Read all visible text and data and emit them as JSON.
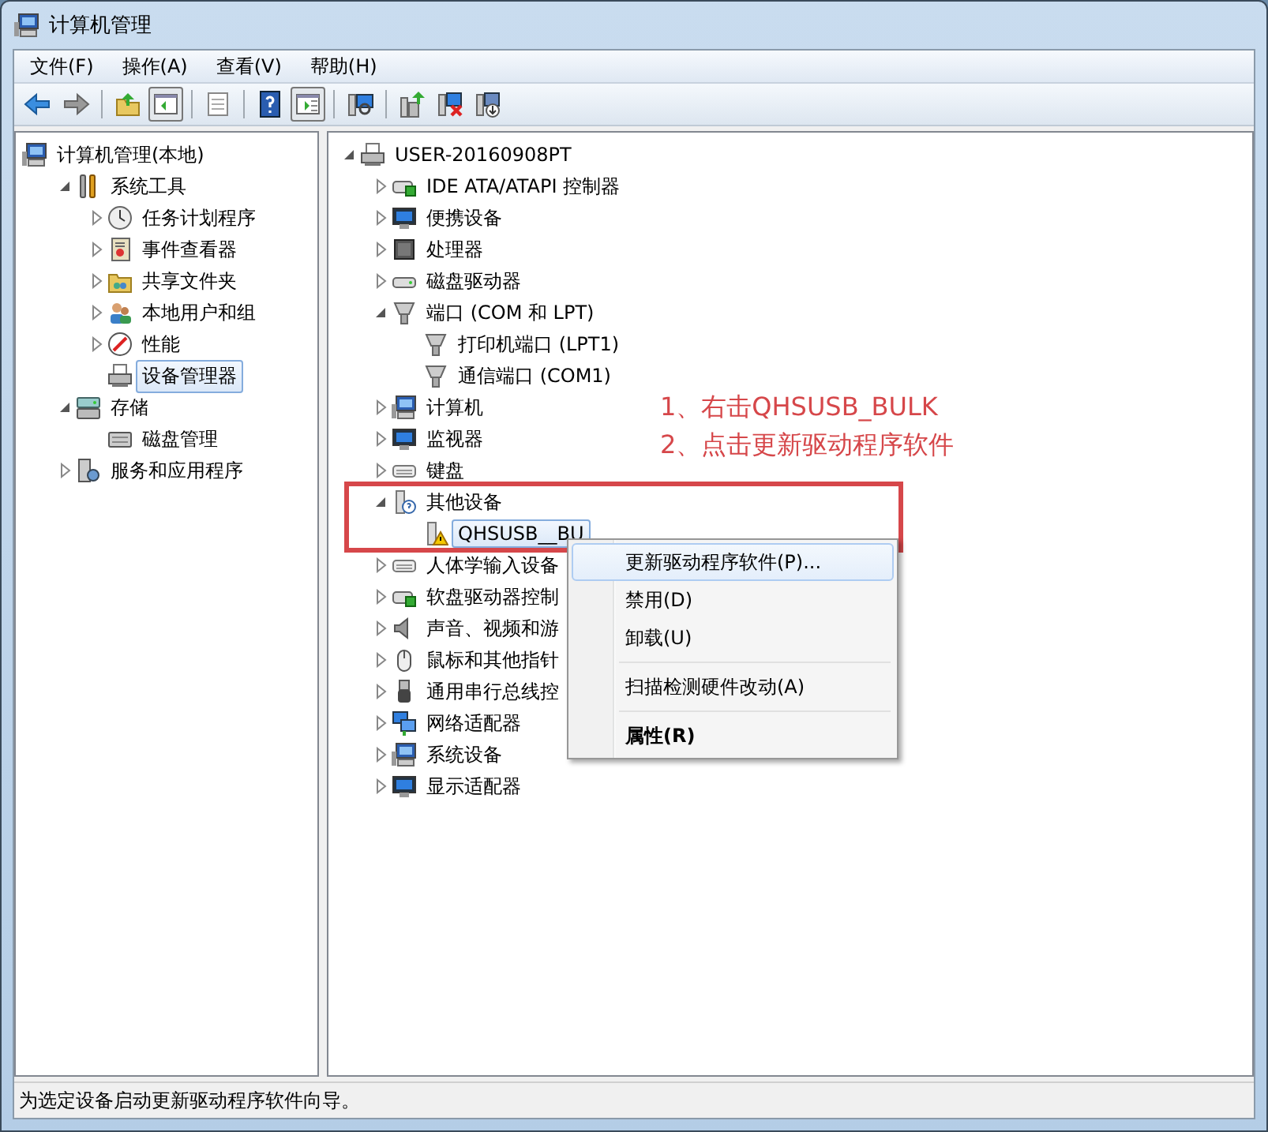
{
  "window": {
    "title": "计算机管理"
  },
  "menu": [
    {
      "label": "文件(F)"
    },
    {
      "label": "操作(A)"
    },
    {
      "label": "查看(V)"
    },
    {
      "label": "帮助(H)"
    }
  ],
  "toolbar": [
    {
      "kind": "back",
      "pressed": false
    },
    {
      "kind": "forward",
      "pressed": false
    },
    {
      "kind": "separator"
    },
    {
      "kind": "up",
      "pressed": false
    },
    {
      "kind": "tree",
      "pressed": true
    },
    {
      "kind": "separator"
    },
    {
      "kind": "page",
      "pressed": false
    },
    {
      "kind": "separator"
    },
    {
      "kind": "help",
      "pressed": false
    },
    {
      "kind": "pane",
      "pressed": true
    },
    {
      "kind": "separator"
    },
    {
      "kind": "scan",
      "pressed": false
    },
    {
      "kind": "separator"
    },
    {
      "kind": "update",
      "pressed": false
    },
    {
      "kind": "remove",
      "pressed": false
    },
    {
      "kind": "install",
      "pressed": false
    }
  ],
  "console_tree": [
    {
      "label": "计算机管理(本地)",
      "selected": false,
      "children": [
        {
          "label": "系统工具",
          "expanded": true,
          "selected": false,
          "children": [
            {
              "label": "任务计划程序",
              "expanded": false,
              "selected": false
            },
            {
              "label": "事件查看器",
              "expanded": false,
              "selected": false
            },
            {
              "label": "共享文件夹",
              "expanded": false,
              "selected": false
            },
            {
              "label": "本地用户和组",
              "expanded": false,
              "selected": false
            },
            {
              "label": "性能",
              "expanded": false,
              "selected": false
            },
            {
              "label": "设备管理器",
              "selected": true
            }
          ]
        },
        {
          "label": "存储",
          "expanded": true,
          "selected": false,
          "children": [
            {
              "label": "磁盘管理",
              "selected": false
            }
          ]
        },
        {
          "label": "服务和应用程序",
          "expanded": false,
          "selected": false
        }
      ]
    }
  ],
  "device_tree": [
    {
      "label": "USER-20160908PT",
      "expanded": true,
      "selected": false,
      "children": [
        {
          "label": "IDE ATA/ATAPI 控制器",
          "expanded": false,
          "selected": false
        },
        {
          "label": "便携设备",
          "expanded": false,
          "selected": false
        },
        {
          "label": "处理器",
          "expanded": false,
          "selected": false
        },
        {
          "label": "磁盘驱动器",
          "expanded": false,
          "selected": false
        },
        {
          "label": "端口 (COM 和 LPT)",
          "expanded": true,
          "selected": false,
          "children": [
            {
              "label": "打印机端口 (LPT1)",
              "selected": false
            },
            {
              "label": "通信端口 (COM1)",
              "selected": false
            }
          ]
        },
        {
          "label": "计算机",
          "expanded": false,
          "selected": false
        },
        {
          "label": "监视器",
          "expanded": false,
          "selected": false
        },
        {
          "label": "键盘",
          "expanded": false,
          "selected": false
        },
        {
          "label": "其他设备",
          "expanded": true,
          "selected": false,
          "children": [
            {
              "label": "QHSUSB__BU",
              "selected": true
            }
          ]
        },
        {
          "label": "人体学输入设备",
          "expanded": false,
          "selected": false
        },
        {
          "label": "软盘驱动器控制",
          "expanded": false,
          "selected": false
        },
        {
          "label": "声音、视频和游",
          "expanded": false,
          "selected": false
        },
        {
          "label": "鼠标和其他指针",
          "expanded": false,
          "selected": false
        },
        {
          "label": "通用串行总线控",
          "expanded": false,
          "selected": false
        },
        {
          "label": "网络适配器",
          "expanded": false,
          "selected": false
        },
        {
          "label": "系统设备",
          "expanded": false,
          "selected": false
        },
        {
          "label": "显示适配器",
          "expanded": false,
          "selected": false
        }
      ]
    }
  ],
  "annotation": {
    "lines": [
      "1、右击QHSUSB_BULK",
      "2、点击更新驱动程序软件"
    ]
  },
  "context_menu": [
    {
      "kind": "item",
      "label": "更新驱动程序软件(P)...",
      "selected": true
    },
    {
      "kind": "item",
      "label": "禁用(D)",
      "selected": false
    },
    {
      "kind": "item",
      "label": "卸载(U)",
      "selected": false
    },
    {
      "kind": "separator"
    },
    {
      "kind": "item",
      "label": "扫描检测硬件改动(A)",
      "selected": false
    },
    {
      "kind": "separator"
    },
    {
      "kind": "default",
      "label": "属性(R)",
      "selected": false
    }
  ],
  "status_bar": {
    "text": "为选定设备启动更新驱动程序软件向导。"
  }
}
